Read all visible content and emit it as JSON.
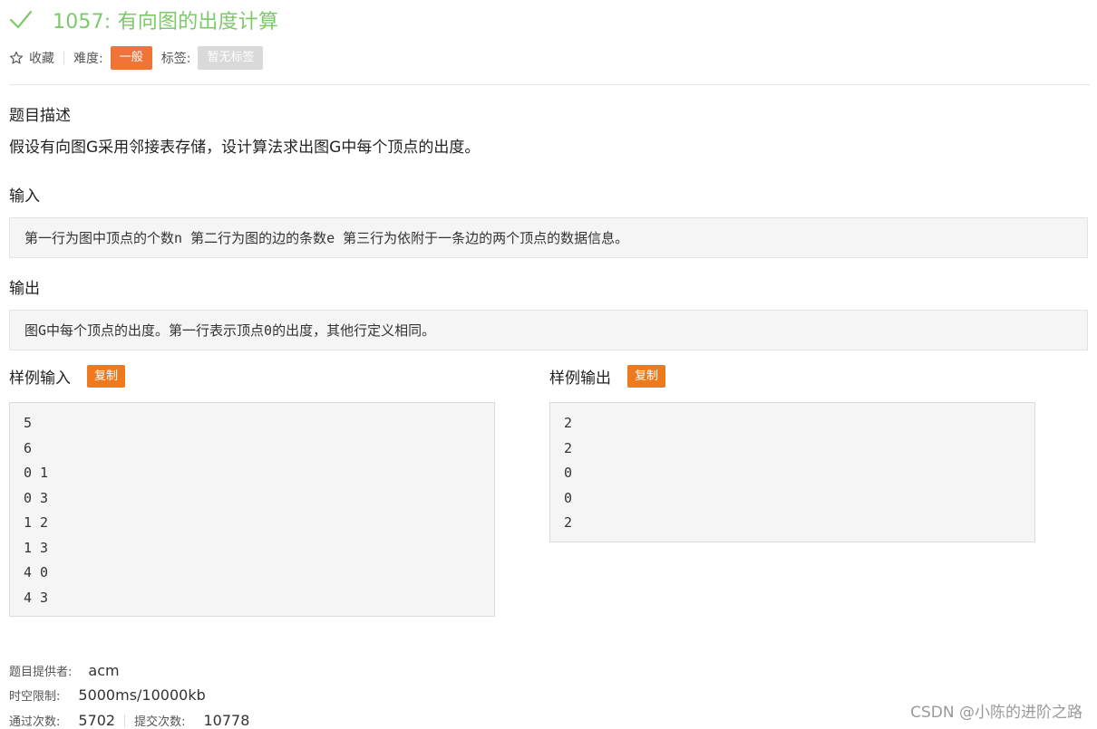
{
  "header": {
    "title": "1057: 有向图的出度计算",
    "accent_color": "#7cc96a"
  },
  "meta": {
    "favorite_label": "收藏",
    "difficulty_label": "难度:",
    "difficulty_value": "一般",
    "difficulty_color": "#f07437",
    "tags_label": "标签:",
    "tags_value": "暂无标签"
  },
  "description": {
    "heading": "题目描述",
    "text": "假设有向图G采用邻接表存储，设计算法求出图G中每个顶点的出度。"
  },
  "input": {
    "heading": "输入",
    "text": "第一行为图中顶点的个数n 第二行为图的边的条数e 第三行为依附于一条边的两个顶点的数据信息。"
  },
  "output": {
    "heading": "输出",
    "text": "图G中每个顶点的出度。第一行表示顶点0的出度，其他行定义相同。"
  },
  "sample_input": {
    "heading": "样例输入",
    "copy_label": "复制",
    "lines": [
      "5",
      "6",
      "0 1",
      "0 3",
      "1 2",
      "1 3",
      "4 0",
      "4 3"
    ]
  },
  "sample_output": {
    "heading": "样例输出",
    "copy_label": "复制",
    "lines": [
      "2",
      "2",
      "0",
      "0",
      "2"
    ]
  },
  "info": {
    "provider_label": "题目提供者:",
    "provider_value": "acm",
    "limit_label": "时空限制:",
    "limit_value": "5000ms/10000kb",
    "pass_label": "通过次数:",
    "pass_value": "5702",
    "submit_label": "提交次数:",
    "submit_value": "10778"
  },
  "watermark": "CSDN @小陈的进阶之路"
}
